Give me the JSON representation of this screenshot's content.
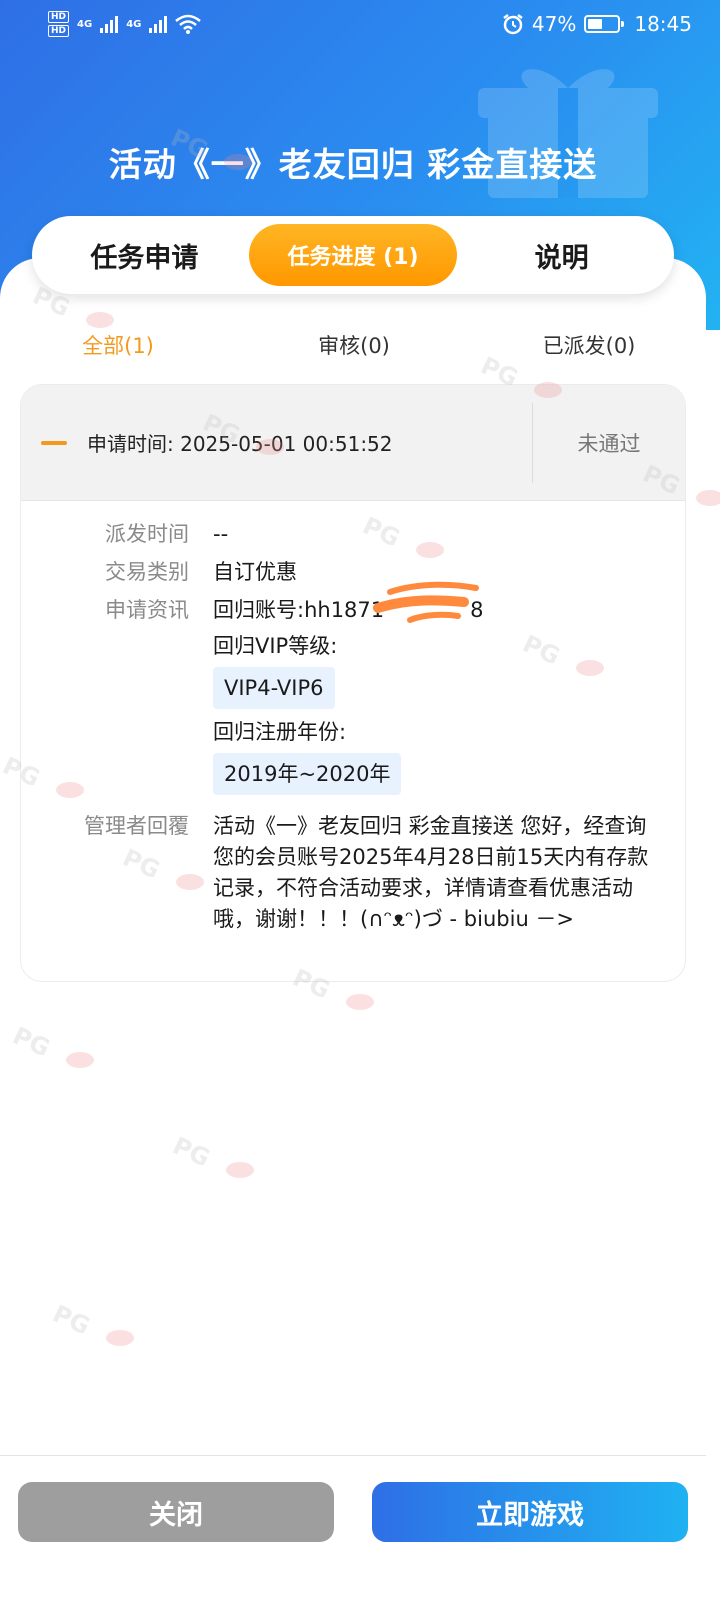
{
  "status_bar": {
    "hd_labels": [
      "HD",
      "HD"
    ],
    "network_1": "4G",
    "network_2": "4G",
    "battery_pct": "47%",
    "battery_level": 0.47,
    "time": "18:45"
  },
  "title": "活动《一》老友回归 彩金直接送",
  "tabs": [
    {
      "label": "任务申请"
    },
    {
      "label": "任务进度 (1)"
    },
    {
      "label": "说明"
    }
  ],
  "subtabs": [
    {
      "label": "全部(1)"
    },
    {
      "label": "审核(0)"
    },
    {
      "label": "已派发(0)"
    }
  ],
  "record": {
    "apply_time": "申请时间: 2025-05-01 00:51:52",
    "status": "未通过",
    "fields": {
      "dispatch_label": "派发时间",
      "dispatch_value": "--",
      "type_label": "交易类别",
      "type_value": "自订优惠",
      "info_label": "申请资讯",
      "account_line": "回归账号:hh1871",
      "account_tail": "8",
      "vip_label": "回归VIP等级:",
      "vip_value": "VIP4-VIP6",
      "reg_label": "回归注册年份:",
      "reg_value": "2019年~2020年",
      "reply_label": "管理者回覆",
      "reply_value": "活动《一》老友回归 彩金直接送  您好，经查询您的会员账号2025年4月28日前15天内有存款记录，不符合活动要求，详情请查看优惠活动哦，谢谢！！！(∩ᵔᴥᵔ)づ - biubiu －>"
    }
  },
  "buttons": {
    "close": "关闭",
    "play": "立即游戏"
  },
  "colors": {
    "accent_orange": "#f39a1e",
    "header_blue": "#2a8df0",
    "scribble": "#ff8a3d"
  }
}
